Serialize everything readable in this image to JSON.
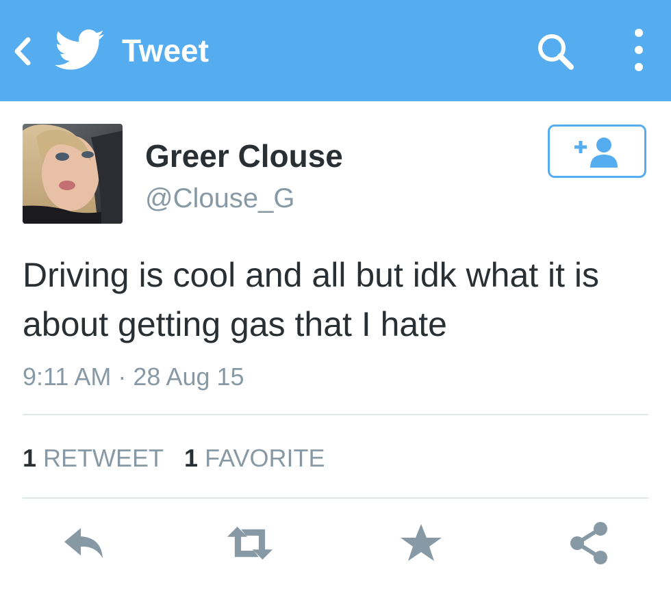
{
  "header": {
    "title": "Tweet",
    "background_color": "#55acee",
    "icons": {
      "back": "chevron-left-icon",
      "logo": "twitter-bird-icon",
      "search": "search-icon",
      "more": "more-vertical-icon"
    }
  },
  "tweet": {
    "user": {
      "name": "Greer Clouse",
      "handle": "@Clouse_G",
      "avatar": "profile-photo"
    },
    "follow_button_icon": "add-user-icon",
    "text": "Driving is cool and all but idk what it is about getting gas that I hate",
    "timestamp": "9:11 AM · 28 Aug 15"
  },
  "stats": {
    "retweets": {
      "count": "1",
      "label": "RETWEET"
    },
    "favorites": {
      "count": "1",
      "label": "FAVORITE"
    }
  },
  "actions": {
    "icons": [
      "reply-icon",
      "retweet-icon",
      "favorite-star-icon",
      "share-icon"
    ],
    "color": "#8899a6"
  }
}
